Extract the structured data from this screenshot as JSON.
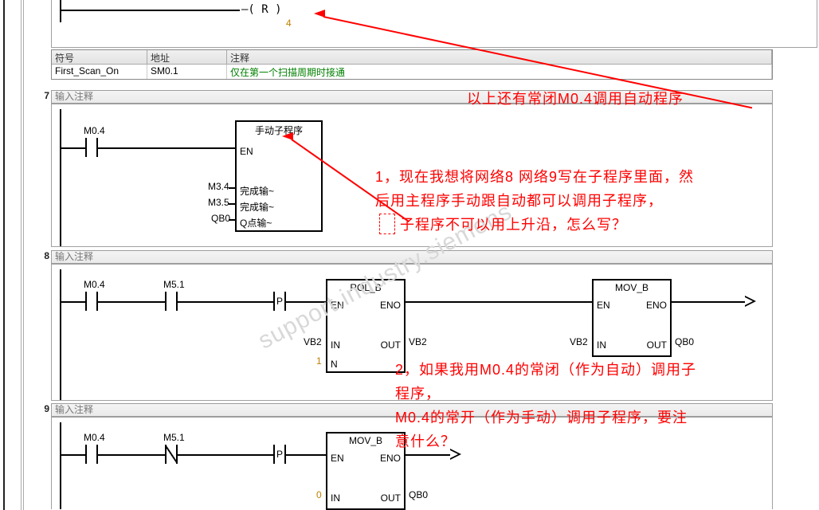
{
  "reset_coil": {
    "symbol": "R",
    "count": "4"
  },
  "symbol_table": {
    "header": {
      "symbol": "符号",
      "address": "地址",
      "comment": "注释"
    },
    "rows": [
      {
        "symbol": "First_Scan_On",
        "address": "SM0.1",
        "comment": "仅在第一个扫描周期时接通"
      }
    ]
  },
  "annotations": {
    "top": "以上还有常闭M0.4调用自动程序",
    "q1_l1": "1，现在我想将网络8 网络9写在子程序里面，然",
    "q1_l2": "后用主程序手动跟自动都可以调用子程序，",
    "q1_l3": "子程序不可以用上升沿，怎么写？",
    "q2_l1": "2，如果我用M0.4的常闭（作为自动）调用子",
    "q2_l2": "程序，",
    "q2_l3": "     M0.4的常开（作为手动）调用子程序，要注",
    "q2_l4": "意什么？"
  },
  "rung7": {
    "num": "7",
    "comment_hint": "输入注释",
    "contact1": "M0.4",
    "block": {
      "title": "手动子程序",
      "en": "EN",
      "pins_left": [
        "完成输~",
        "完成输~",
        "Q点输~"
      ],
      "pins_left_addr": [
        "M3.4",
        "M3.5",
        "QB0"
      ]
    }
  },
  "rung8": {
    "num": "8",
    "comment_hint": "输入注释",
    "contact1": "M0.4",
    "contact2": "M5.1",
    "p_label": "P",
    "rolb": {
      "title": "ROL_B",
      "en": "EN",
      "eno": "ENO",
      "in": "IN",
      "out": "OUT",
      "n": "N",
      "in_addr": "VB2",
      "out_addr": "VB2",
      "n_val": "1"
    },
    "movb": {
      "title": "MOV_B",
      "en": "EN",
      "eno": "ENO",
      "in": "IN",
      "out": "OUT",
      "in_addr": "VB2",
      "out_addr": "QB0"
    }
  },
  "rung9": {
    "num": "9",
    "comment_hint": "输入注释",
    "contact1": "M0.4",
    "contact2": "M5.1",
    "p_label": "P",
    "movb": {
      "title": "MOV_B",
      "en": "EN",
      "eno": "ENO",
      "in": "IN",
      "out": "OUT",
      "in_val": "0",
      "out_addr": "QB0"
    }
  },
  "watermark": "support.industry.siemens"
}
